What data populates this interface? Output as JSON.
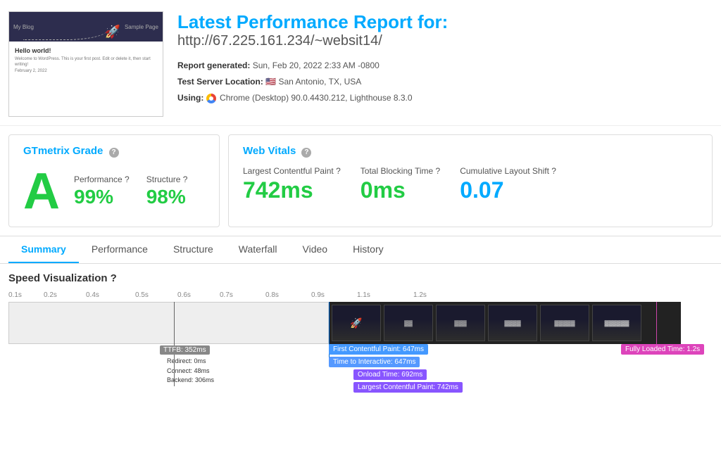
{
  "header": {
    "title_line1": "Latest Performance Report for:",
    "title_line2": "http://67.225.161.234/~websit14/",
    "report_generated_label": "Report generated:",
    "report_generated_value": "Sun, Feb 20, 2022 2:33 AM -0800",
    "test_server_label": "Test Server Location:",
    "test_server_value": "San Antonio, TX, USA",
    "using_label": "Using:",
    "using_value": "Chrome (Desktop) 90.0.4430.212, Lighthouse 8.3.0",
    "flag": "🇺🇸"
  },
  "grade": {
    "section_title": "GTmetrix Grade",
    "help": "?",
    "letter": "A",
    "performance_label": "Performance",
    "performance_value": "99%",
    "structure_label": "Structure",
    "structure_value": "98%"
  },
  "vitals": {
    "section_title": "Web Vitals",
    "help": "?",
    "lcp_label": "Largest Contentful Paint",
    "lcp_value": "742ms",
    "tbt_label": "Total Blocking Time",
    "tbt_value": "0ms",
    "cls_label": "Cumulative Layout Shift",
    "cls_value": "0.07"
  },
  "tabs": [
    {
      "label": "Summary",
      "active": true
    },
    {
      "label": "Performance",
      "active": false
    },
    {
      "label": "Structure",
      "active": false
    },
    {
      "label": "Waterfall",
      "active": false
    },
    {
      "label": "Video",
      "active": false
    },
    {
      "label": "History",
      "active": false
    }
  ],
  "speed_viz": {
    "section_title": "Speed Visualization",
    "help": "?",
    "ruler_ticks": [
      "0.1s",
      "0.2s",
      "0.4s",
      "0.5s",
      "0.6s",
      "0.7s",
      "0.8s",
      "0.9s",
      "1.1s",
      "1.2s"
    ],
    "ttfb_label": "TTFB: 352ms",
    "ttfb_redirect": "Redirect: 0ms",
    "ttfb_connect": "Connect: 48ms",
    "ttfb_backend": "Backend: 306ms",
    "fcp_label": "First Contentful Paint: 647ms",
    "tti_label": "Time to Interactive: 647ms",
    "onload_label": "Onload Time: 692ms",
    "lcp_label": "Largest Contentful Paint: 742ms",
    "flt_label": "Fully Loaded Time: 1.2s"
  }
}
